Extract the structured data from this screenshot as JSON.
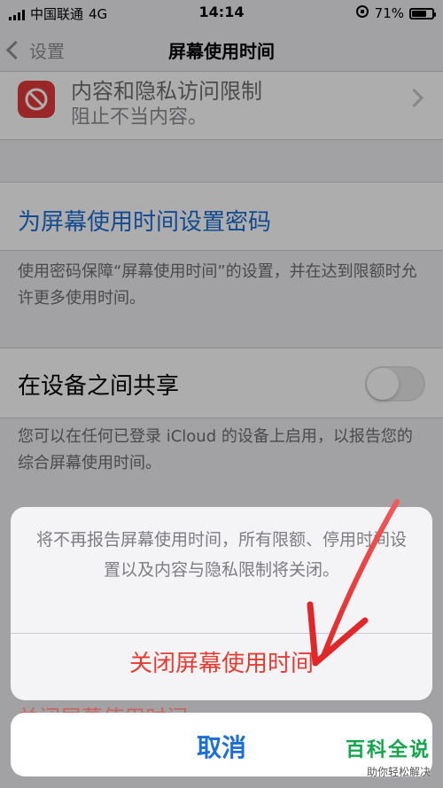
{
  "status_bar": {
    "carrier": "中国联通",
    "network": "4G",
    "time": "14:14",
    "battery": "71%",
    "battery_level": 0.71
  },
  "nav": {
    "back_label": "设置",
    "title": "屏幕使用时间"
  },
  "restrictions": {
    "title": "内容和隐私访问限制",
    "subtitle": "阻止不当内容。"
  },
  "passcode": {
    "label": "为屏幕使用时间设置密码",
    "footnote": "使用密码保障“屏幕使用时间”的设置，并在达到限额时允许更多使用时间。"
  },
  "share": {
    "label": "在设备之间共享",
    "enabled": false,
    "footnote": "您可以在任何已登录 iCloud 的设备上启用，以报告您的综合屏幕使用时间。"
  },
  "action_sheet": {
    "message": "将不再报告屏幕使用时间，所有限额、停用时间设置以及内容与隐私限制将关闭。",
    "destructive_label": "关闭屏幕使用时间",
    "peek_label": "关闭屏幕使用时间",
    "cancel_label": "取消"
  },
  "colors": {
    "accent_blue": "#1c6fd8",
    "destructive_red": "#e53b31",
    "restrict_icon_bg": "#e5393b",
    "watermark_green": "#13a54a"
  },
  "watermark": {
    "title": "百科全说",
    "subtitle": "助你轻松解决"
  },
  "icons": {
    "restrict": "no-entry-icon",
    "back": "chevron-left-icon",
    "chevron": "chevron-right-icon",
    "signal": "signal-bars-icon",
    "rotation_lock": "rotation-lock-icon",
    "battery": "battery-icon"
  }
}
